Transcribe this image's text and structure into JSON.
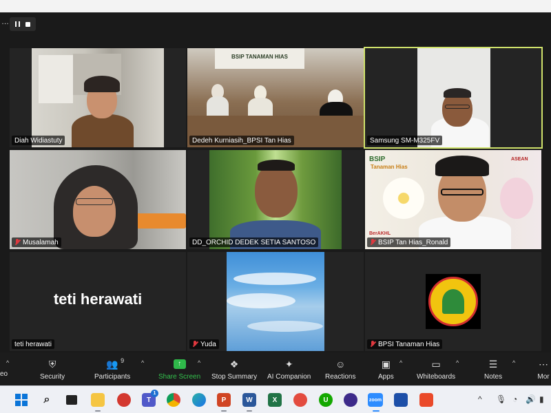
{
  "participants": [
    {
      "name": "Diah Widiastuty",
      "muted": false
    },
    {
      "name": "Dedeh Kurniasih_BPSI Tan Hias",
      "muted": false
    },
    {
      "name": "Samsung SM-M325FV",
      "muted": false,
      "active_speaker": true
    },
    {
      "name": "Musalamah",
      "muted": true
    },
    {
      "name": "DD_ORCHID DEDEK SETIA SANTOSO",
      "muted": false
    },
    {
      "name": "BSIP Tan Hias_Ronald",
      "muted": true
    },
    {
      "name": "teti herawati",
      "muted": false,
      "display_text": "teti herawati"
    },
    {
      "name": "Yuda",
      "muted": true
    },
    {
      "name": "BPSI Tanaman Hias",
      "muted": true
    }
  ],
  "tile_text": {
    "banner": "BSIP TANAMAN HIAS",
    "bsip_logo": "BSIP",
    "bsip_sub": "Tanaman Hias",
    "asean": "ASEAN",
    "berakhl": "BerAKHL"
  },
  "toolbar": {
    "video_partial": "eo",
    "security": "Security",
    "participants": "Participants",
    "participants_count": "9",
    "share_screen": "Share Screen",
    "stop_summary": "Stop Summary",
    "ai_companion": "AI Companion",
    "reactions": "Reactions",
    "apps": "Apps",
    "whiteboards": "Whiteboards",
    "notes": "Notes",
    "more_partial": "Mor"
  },
  "taskbar": {
    "teams_badge": "1",
    "zoom_label": "zoom",
    "apps": [
      "windows-start",
      "search",
      "task-view",
      "file-explorer",
      "chrome-like",
      "teams",
      "chrome",
      "edge",
      "powerpoint",
      "word",
      "excel",
      "app-red",
      "upwork",
      "app-purple",
      "zoom",
      "app-shield",
      "app-orange"
    ]
  },
  "colors": {
    "active_border": "#cfe26b",
    "share_green": "#33c24d",
    "muted_red": "#e0383e",
    "toolbar_bg": "#1c1c1c"
  }
}
